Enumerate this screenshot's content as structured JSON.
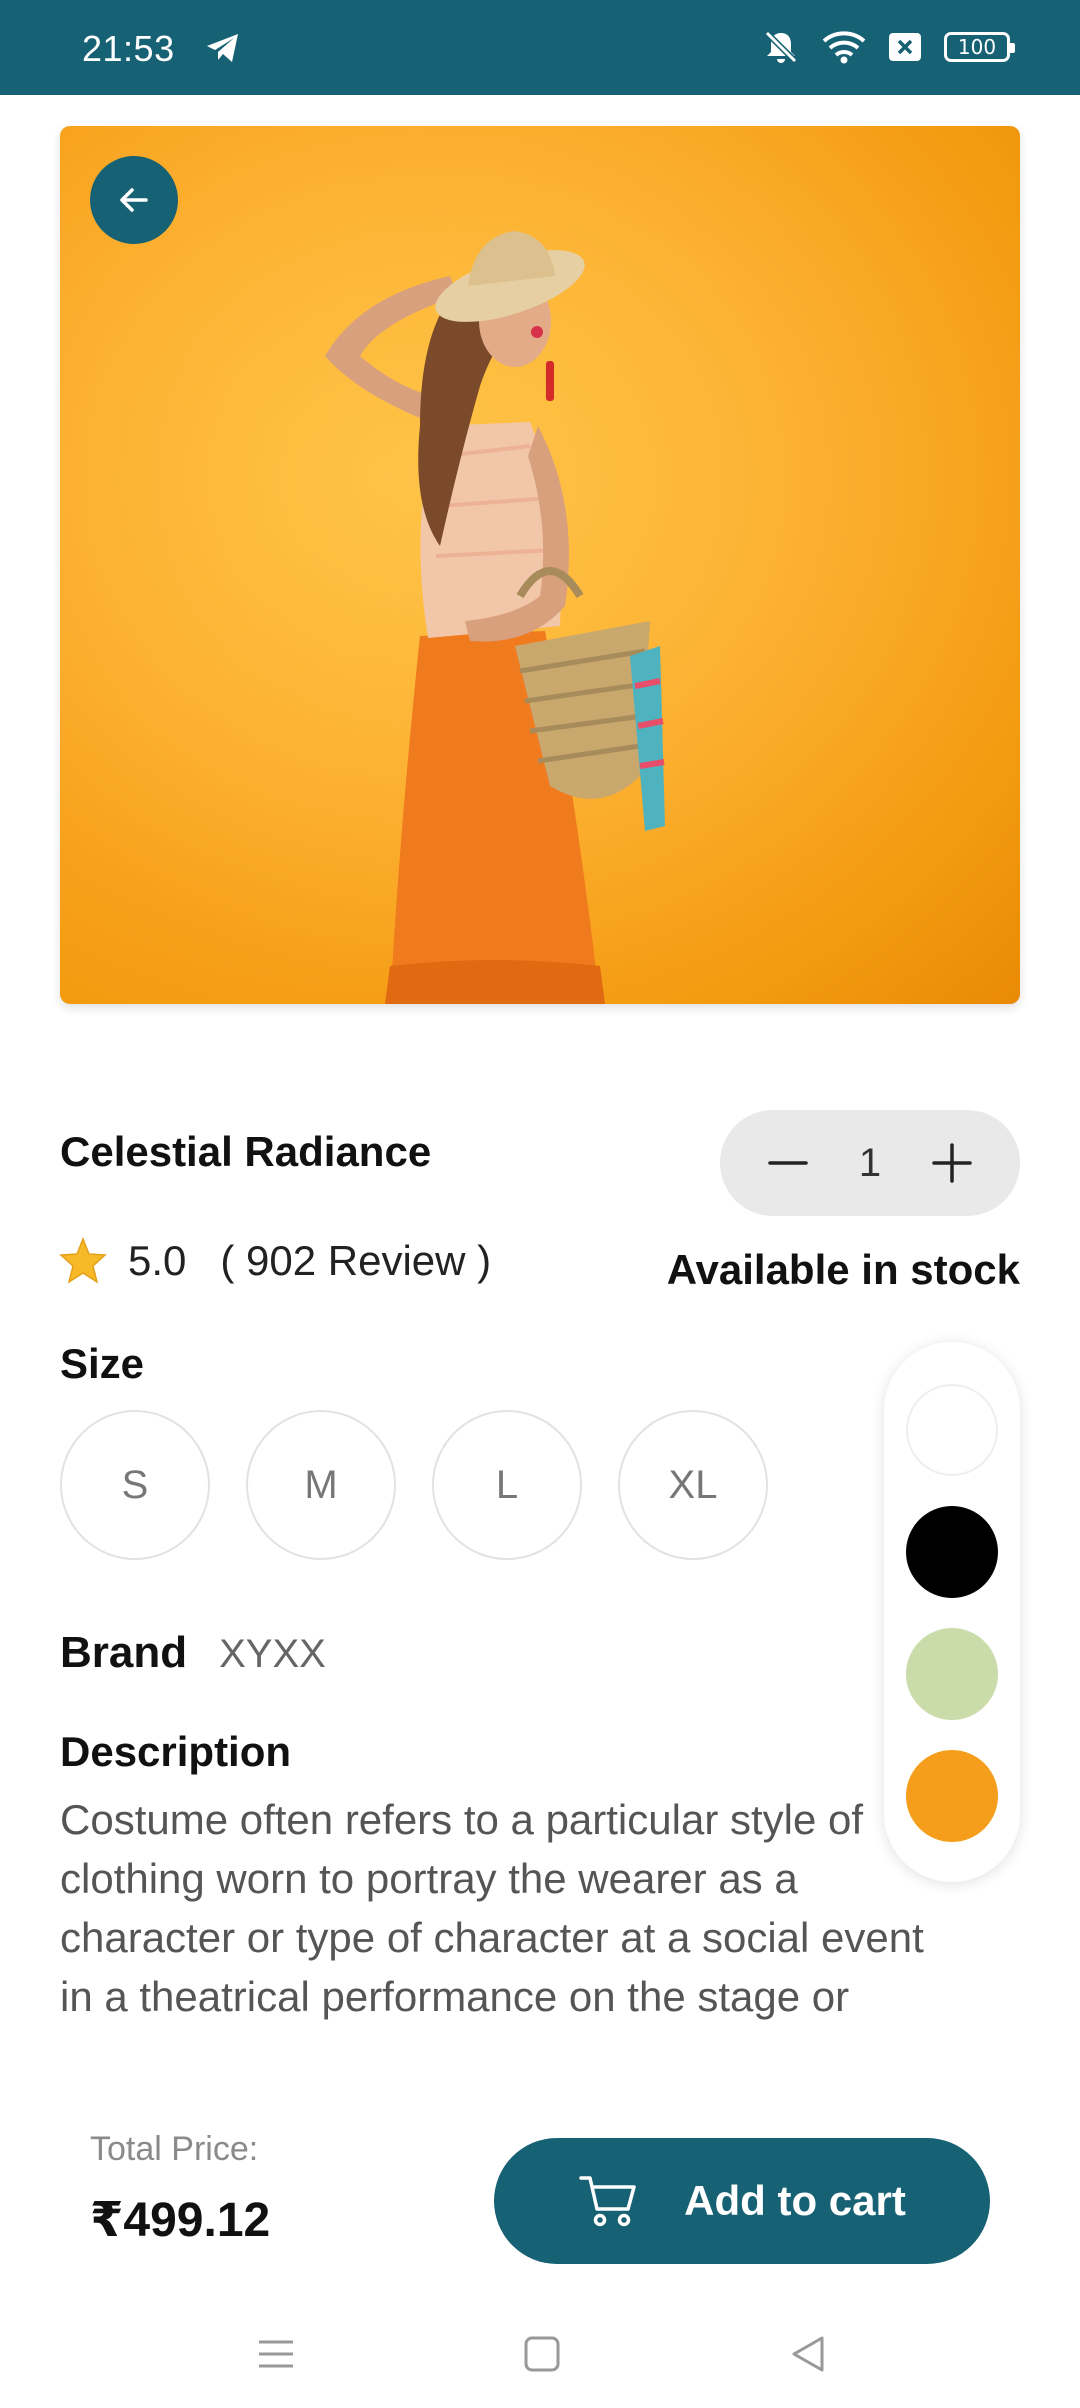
{
  "status_bar": {
    "time": "21:53",
    "battery": "100",
    "icons": [
      "telegram-icon",
      "bell-muted-icon",
      "wifi-icon",
      "sim-off-icon",
      "battery-icon"
    ],
    "bg_color": "#176174"
  },
  "product": {
    "image_desc": "woman in straw hat holding woven basket on orange background",
    "name": "Celestial Radiance",
    "rating": "5.0",
    "reviews": "( 902 Review )",
    "stock": "Available in stock",
    "quantity": "1",
    "size_title": "Size",
    "sizes": [
      "S",
      "M",
      "L",
      "XL"
    ],
    "colors": [
      "#ffffff",
      "#000000",
      "#c9dcaa",
      "#f49e1c"
    ],
    "brand_label": "Brand",
    "brand_value": "XYXX",
    "description_title": "Description",
    "description": "Costume often refers to a particular style of clothing worn to portray the wearer as a character or type of character at a social event in a theatrical performance on the stage or"
  },
  "checkout": {
    "total_label": "Total Price:",
    "total_value": "₹499.12",
    "add_to_cart": "Add to cart"
  },
  "theme": {
    "accent": "#176174",
    "star": "#f7b928"
  }
}
